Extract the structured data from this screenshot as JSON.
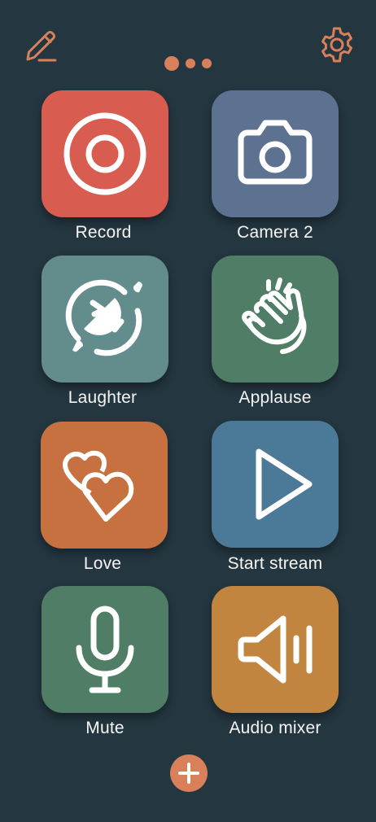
{
  "toolbar": {
    "edit_icon": "pencil-icon",
    "settings_icon": "gear-icon"
  },
  "pager": {
    "page_count": 3,
    "active_page": 1
  },
  "tiles": [
    {
      "label": "Record",
      "icon": "record-icon",
      "color": "#d95c51"
    },
    {
      "label": "Camera 2",
      "icon": "camera-icon",
      "color": "#5d7291"
    },
    {
      "label": "Laughter",
      "icon": "laughing-face-icon",
      "color": "#638d8c"
    },
    {
      "label": "Applause",
      "icon": "clapping-hands-icon",
      "color": "#4f7d66"
    },
    {
      "label": "Love",
      "icon": "hearts-icon",
      "color": "#c77140"
    },
    {
      "label": "Start stream",
      "icon": "play-icon",
      "color": "#4b7998"
    },
    {
      "label": "Mute",
      "icon": "microphone-icon",
      "color": "#4f7d66"
    },
    {
      "label": "Audio mixer",
      "icon": "speaker-icon",
      "color": "#c2853f"
    }
  ],
  "add_button": {
    "icon": "plus-icon"
  },
  "colors": {
    "background": "#243640",
    "accent": "#d8805a",
    "icon_stroke": "#ffffff",
    "label_text": "#f5f5f5"
  }
}
